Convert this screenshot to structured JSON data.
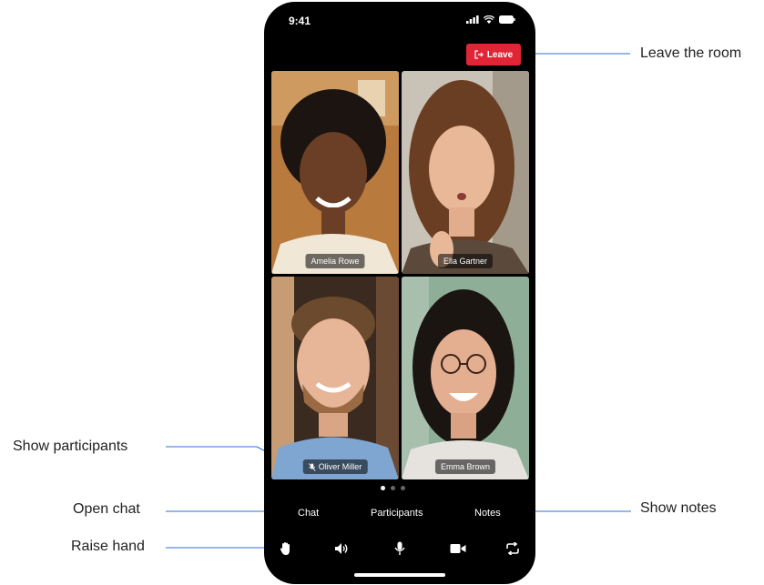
{
  "status_bar": {
    "time": "9:41"
  },
  "leave_button": {
    "label": "Leave"
  },
  "participants": [
    {
      "name": "Amelia Rowe"
    },
    {
      "name": "Ella Gartner"
    },
    {
      "name": "Oliver Miller",
      "muted": true
    },
    {
      "name": "Emma Brown"
    }
  ],
  "pager": {
    "pages": 3,
    "active": 1
  },
  "tabs": {
    "chat": "Chat",
    "participants": "Participants",
    "notes": "Notes"
  },
  "controls": [
    "hand-icon",
    "speaker-icon",
    "mic-icon",
    "camera-icon",
    "switch-camera-icon"
  ],
  "callouts": {
    "leave": "Leave the room",
    "show_participants": "Show participants",
    "open_chat": "Open chat",
    "show_notes": "Show notes",
    "raise_hand": "Raise hand"
  },
  "colors": {
    "leave": "#e02636",
    "callout_line": "#2f6fd6",
    "phone": "#000000"
  }
}
